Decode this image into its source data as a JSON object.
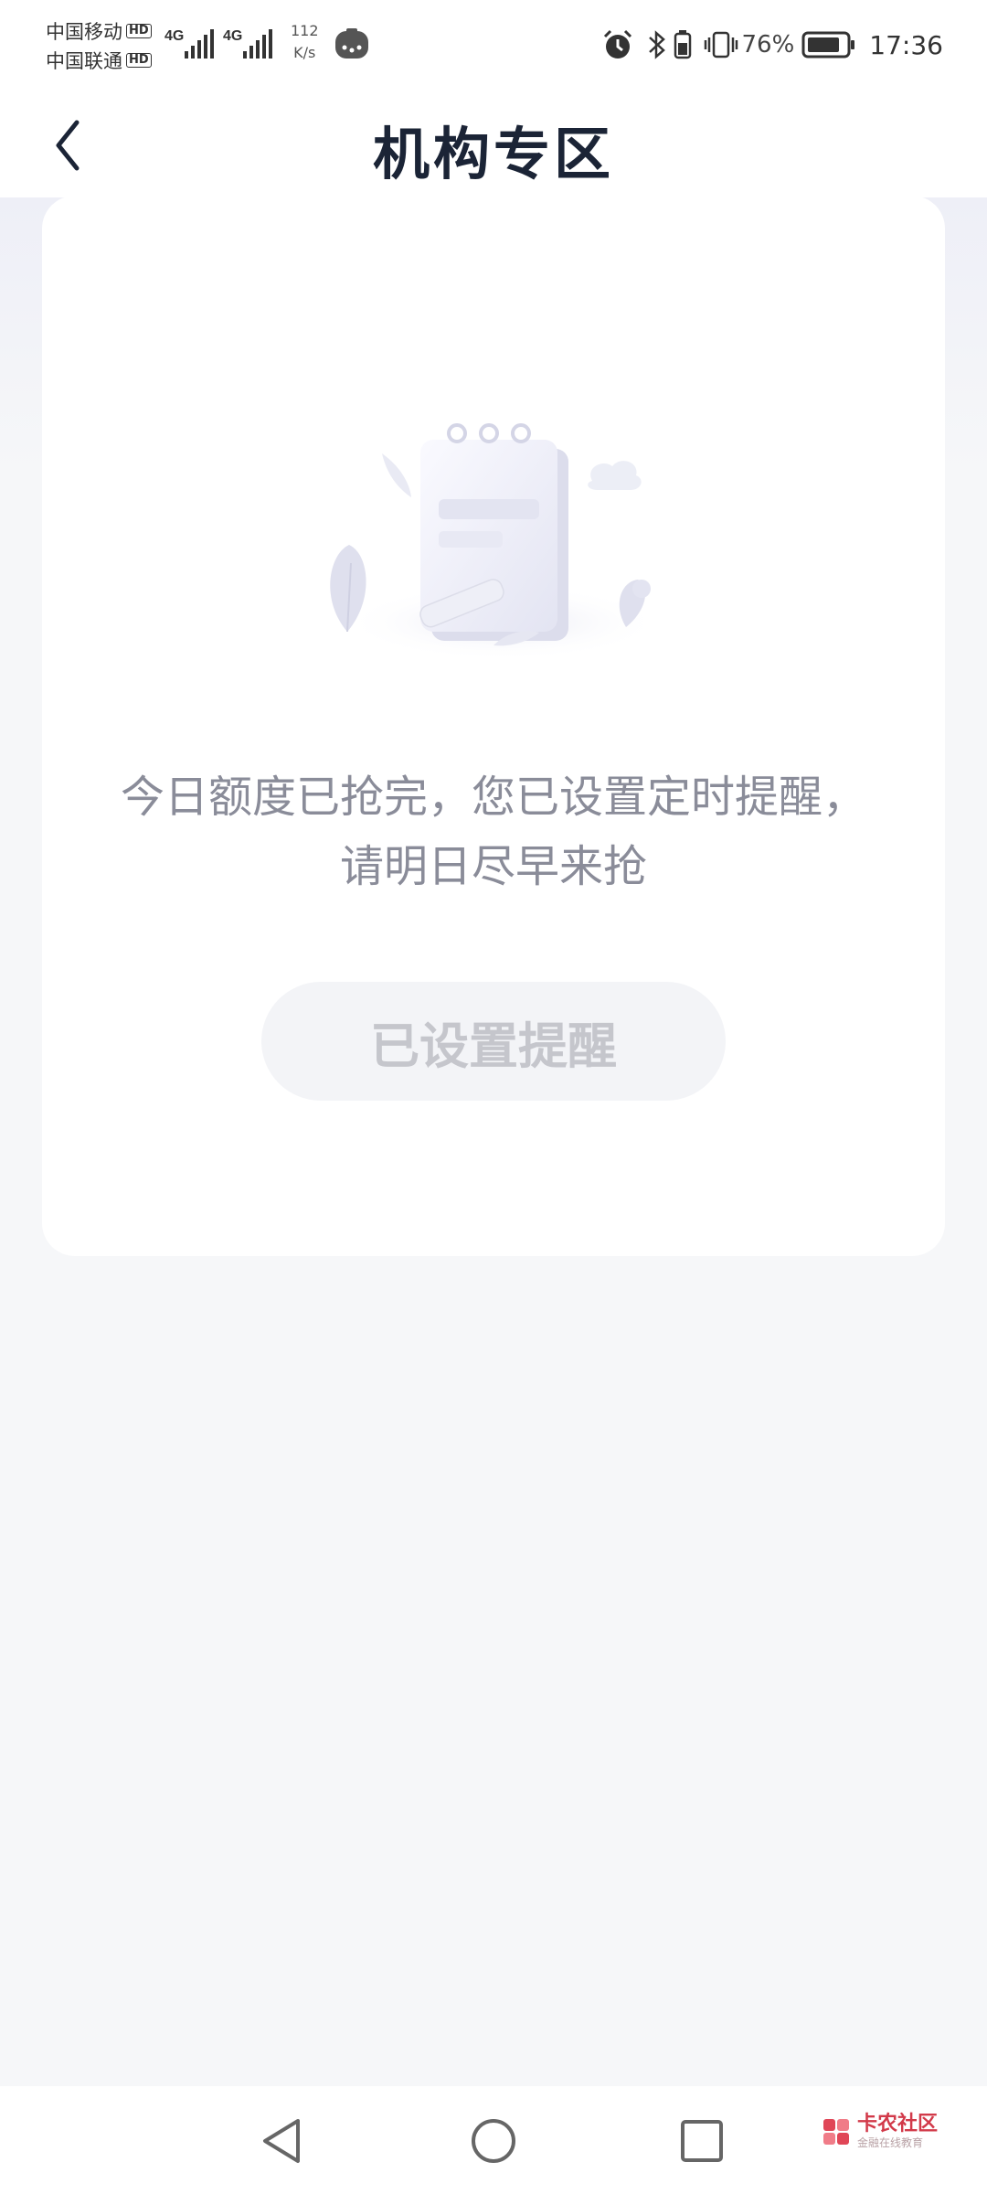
{
  "status_bar": {
    "carrier1": "中国移动",
    "carrier2": "中国联通",
    "hd_badge": "HD",
    "net_type1": "4G",
    "net_type2": "4G",
    "net_speed_value": "112",
    "net_speed_unit": "K/s",
    "battery_pct": "76%",
    "time": "17:36",
    "icons": [
      "alarm-icon",
      "bluetooth-icon",
      "battery-saver-icon",
      "vibrate-icon",
      "battery-icon"
    ]
  },
  "header": {
    "title": "机构专区",
    "back_icon": "chevron-left-icon"
  },
  "empty_state": {
    "illustration": "empty-notepad-illustration",
    "message_line1": "今日额度已抢完，您已设置定时提醒，",
    "message_line2": "请明日尽早来抢",
    "button_label": "已设置提醒"
  },
  "system_nav": {
    "back": "triangle-back-icon",
    "home": "circle-home-icon",
    "recents": "square-recents-icon"
  },
  "watermark": {
    "title": "卡农社区",
    "subtitle": "金融在线教育"
  },
  "colors": {
    "title": "#1b2436",
    "message": "#8a8c99",
    "button_bg": "#f3f4f7",
    "button_text": "#c5c6cc",
    "page_bg": "#f6f7f9"
  }
}
